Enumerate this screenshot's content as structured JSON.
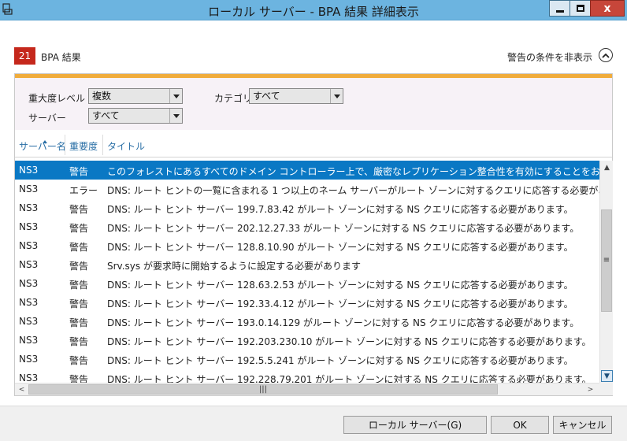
{
  "window": {
    "title": "ローカル サーバー - BPA 結果 詳細表示",
    "close_glyph": "x"
  },
  "header": {
    "count": "21",
    "section_title": "BPA 結果",
    "hide_criteria_label": "警告の条件を非表示"
  },
  "filters": {
    "severity_label": "重大度レベル",
    "severity_value": "複数",
    "category_label": "カテゴリ",
    "category_value": "すべて",
    "server_label": "サーバー",
    "server_value": "すべて"
  },
  "table": {
    "columns": [
      "サーバー名",
      "重要度",
      "タイトル"
    ],
    "rows": [
      {
        "server": "NS3",
        "severity": "警告",
        "title": "このフォレストにあるすべてのドメイン コントローラー上で、厳密なレプリケーション整合性を有効にすることをお勧めします",
        "selected": true
      },
      {
        "server": "NS3",
        "severity": "エラー",
        "title": "DNS: ルート ヒントの一覧に含まれる 1 つ以上のネーム サーバーがルート ゾーンに対するクエリに応答する必要があります。"
      },
      {
        "server": "NS3",
        "severity": "警告",
        "title": "DNS: ルート ヒント サーバー 199.7.83.42 がルート ゾーンに対する NS クエリに応答する必要があります。"
      },
      {
        "server": "NS3",
        "severity": "警告",
        "title": "DNS: ルート ヒント サーバー 202.12.27.33 がルート ゾーンに対する NS クエリに応答する必要があります。"
      },
      {
        "server": "NS3",
        "severity": "警告",
        "title": "DNS: ルート ヒント サーバー 128.8.10.90 がルート ゾーンに対する NS クエリに応答する必要があります。"
      },
      {
        "server": "NS3",
        "severity": "警告",
        "title": "Srv.sys が要求時に開始するように設定する必要があります"
      },
      {
        "server": "NS3",
        "severity": "警告",
        "title": "DNS: ルート ヒント サーバー 128.63.2.53 がルート ゾーンに対する NS クエリに応答する必要があります。"
      },
      {
        "server": "NS3",
        "severity": "警告",
        "title": "DNS: ルート ヒント サーバー 192.33.4.12 がルート ゾーンに対する NS クエリに応答する必要があります。"
      },
      {
        "server": "NS3",
        "severity": "警告",
        "title": "DNS: ルート ヒント サーバー 193.0.14.129 がルート ゾーンに対する NS クエリに応答する必要があります。"
      },
      {
        "server": "NS3",
        "severity": "警告",
        "title": "DNS: ルート ヒント サーバー 192.203.230.10 がルート ゾーンに対する NS クエリに応答する必要があります。"
      },
      {
        "server": "NS3",
        "severity": "警告",
        "title": "DNS: ルート ヒント サーバー 192.5.5.241 がルート ゾーンに対する NS クエリに応答する必要があります。"
      },
      {
        "server": "NS3",
        "severity": "警告",
        "title": "DNS: ルート ヒント サーバー 192.228.79.201 がルート ゾーンに対する NS クエリに応答する必要があります。"
      }
    ]
  },
  "footer": {
    "local_server_button": "ローカル サーバー(G)",
    "ok_button": "OK",
    "cancel_button": "キャンセル"
  },
  "colors": {
    "titlebar": "#6cb4e0",
    "badge": "#c5281c",
    "accent": "#f0ac3c",
    "selection": "#0a78c4",
    "link_header": "#2a6fa6"
  }
}
